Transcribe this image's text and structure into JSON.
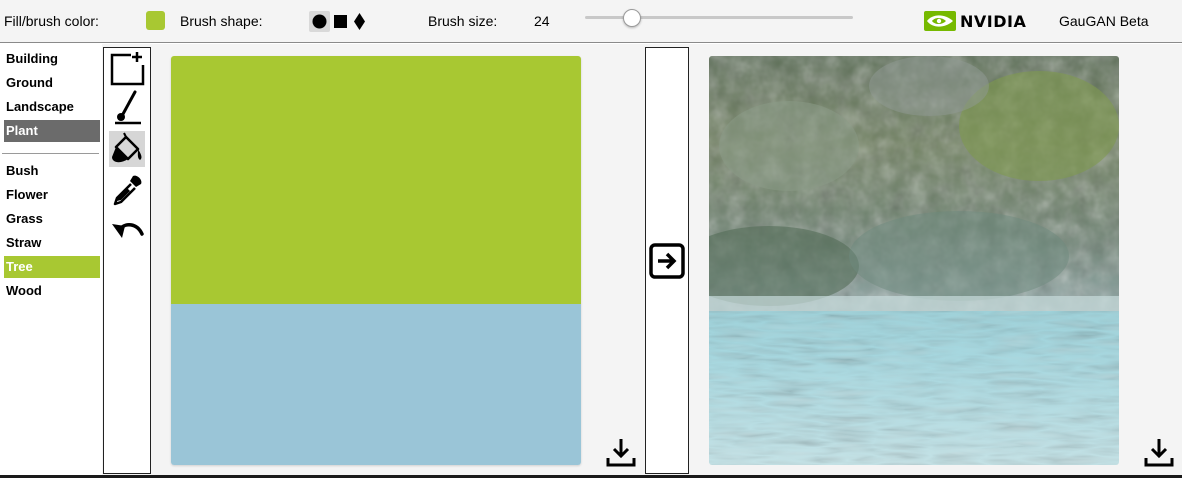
{
  "toolbar": {
    "fill_label": "Fill/brush color:",
    "fill_color": "#a8c832",
    "shape_label": "Brush shape:",
    "shapes": [
      "circle",
      "square",
      "diamond"
    ],
    "selected_shape": "circle",
    "size_label": "Brush size:",
    "size_value": "24",
    "size_fraction": 0.1,
    "brand": "NVIDIA",
    "app_title": "GauGAN Beta"
  },
  "labels": {
    "categories": [
      {
        "label": "Building",
        "selected": false
      },
      {
        "label": "Ground",
        "selected": false
      },
      {
        "label": "Landscape",
        "selected": false
      },
      {
        "label": "Plant",
        "selected": true
      }
    ],
    "subcategories": [
      {
        "label": "Bush",
        "selected": false
      },
      {
        "label": "Flower",
        "selected": false
      },
      {
        "label": "Grass",
        "selected": false
      },
      {
        "label": "Straw",
        "selected": false
      },
      {
        "label": "Tree",
        "selected": true
      },
      {
        "label": "Wood",
        "selected": false
      }
    ]
  },
  "tools": [
    {
      "name": "new-canvas-icon",
      "selected": false
    },
    {
      "name": "brush-icon",
      "selected": false
    },
    {
      "name": "paint-bucket-icon",
      "selected": true
    },
    {
      "name": "eyedropper-icon",
      "selected": false
    },
    {
      "name": "undo-icon",
      "selected": false
    }
  ],
  "segmentation": {
    "regions": [
      {
        "class": "Tree",
        "color": "#a8c832",
        "fraction": 0.607
      },
      {
        "class": "Water",
        "color": "#9ac5d7",
        "fraction": 0.393
      }
    ]
  },
  "icons": {
    "generate": "arrow-right-box-icon",
    "download": "download-icon"
  },
  "colors": {
    "category_selected_bg": "#6b6b6b",
    "subcategory_selected_bg": "#a8c832",
    "nvidia_green": "#76b900"
  }
}
